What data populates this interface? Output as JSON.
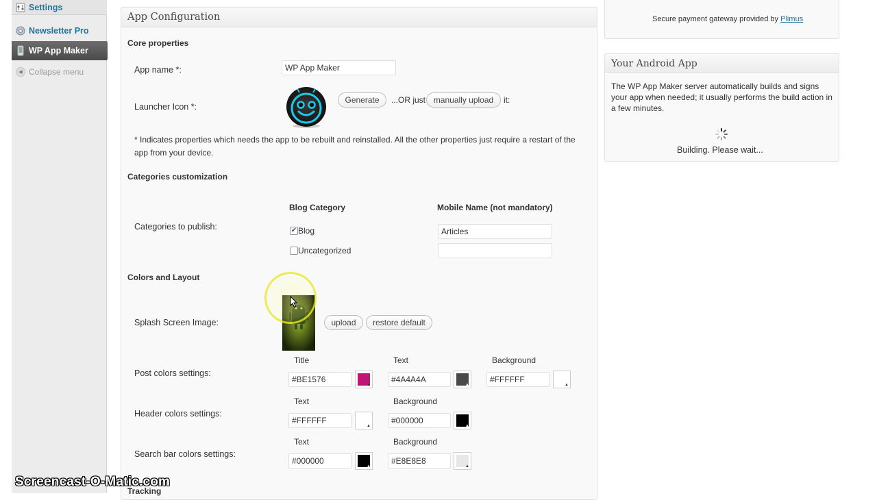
{
  "admin_menu": {
    "settings_label": "Settings",
    "newsletter_label": "Newsletter Pro",
    "appmaker_label": "WP App Maker",
    "collapse_label": "Collapse menu"
  },
  "main": {
    "box_title": "App Configuration",
    "core": {
      "title": "Core properties",
      "app_name_label": "App name *:",
      "app_name_value": "WP App Maker",
      "launcher_label": "Launcher Icon *:",
      "generate_button": "Generate",
      "or_just_text": "...OR just",
      "manual_upload_button": "manually upload",
      "it_text": "it:",
      "note": "* Indicates properties which needs the app to be rebuilt and reinstalled. All the other properties just require a restart of the app from your device."
    },
    "categories": {
      "title": "Categories customization",
      "col_blog_category": "Blog Category",
      "col_mobile_name": "Mobile Name (not mandatory)",
      "publish_label": "Categories to publish:",
      "rows": [
        {
          "name": "Blog",
          "checked": true,
          "mobile_name": "Articles"
        },
        {
          "name": "Uncategorized",
          "checked": false,
          "mobile_name": ""
        }
      ]
    },
    "colors": {
      "title": "Colors and Layout",
      "splash_label": "Splash Screen Image:",
      "upload_button": "upload",
      "restore_button": "restore default",
      "post": {
        "label": "Post colors settings:",
        "title_head": "Title",
        "title_value": "#BE1576",
        "title_color": "#BE1576",
        "text_head": "Text",
        "text_value": "#4A4A4A",
        "text_color": "#4A4A4A",
        "bg_head": "Background",
        "bg_value": "#FFFFFF",
        "bg_color": "#FFFFFF"
      },
      "header": {
        "label": "Header colors settings:",
        "text_head": "Text",
        "text_value": "#FFFFFF",
        "text_color": "#FFFFFF",
        "bg_head": "Background",
        "bg_value": "#000000",
        "bg_color": "#000000"
      },
      "search": {
        "label": "Search bar colors settings:",
        "text_head": "Text",
        "text_value": "#000000",
        "text_color": "#000000",
        "bg_head": "Background",
        "bg_value": "#E8E8E8",
        "bg_color": "#E8E8E8"
      }
    },
    "next_section_partial": "Tracking"
  },
  "sidebar": {
    "gateway_prefix": "Secure payment gateway provided by",
    "gateway_link": "Plimus",
    "android_title": "Your Android App",
    "android_text": "The WP App Maker server automatically builds and signs your app when needed; it usually performs the build action in a few minutes.",
    "building_text": "Building. Please wait..."
  },
  "watermark": "Screencast-O-Matic.com",
  "colors": {
    "link": "#21759b",
    "menu_active": "#5a5a5a",
    "accent_check": "#2a5a9a"
  }
}
